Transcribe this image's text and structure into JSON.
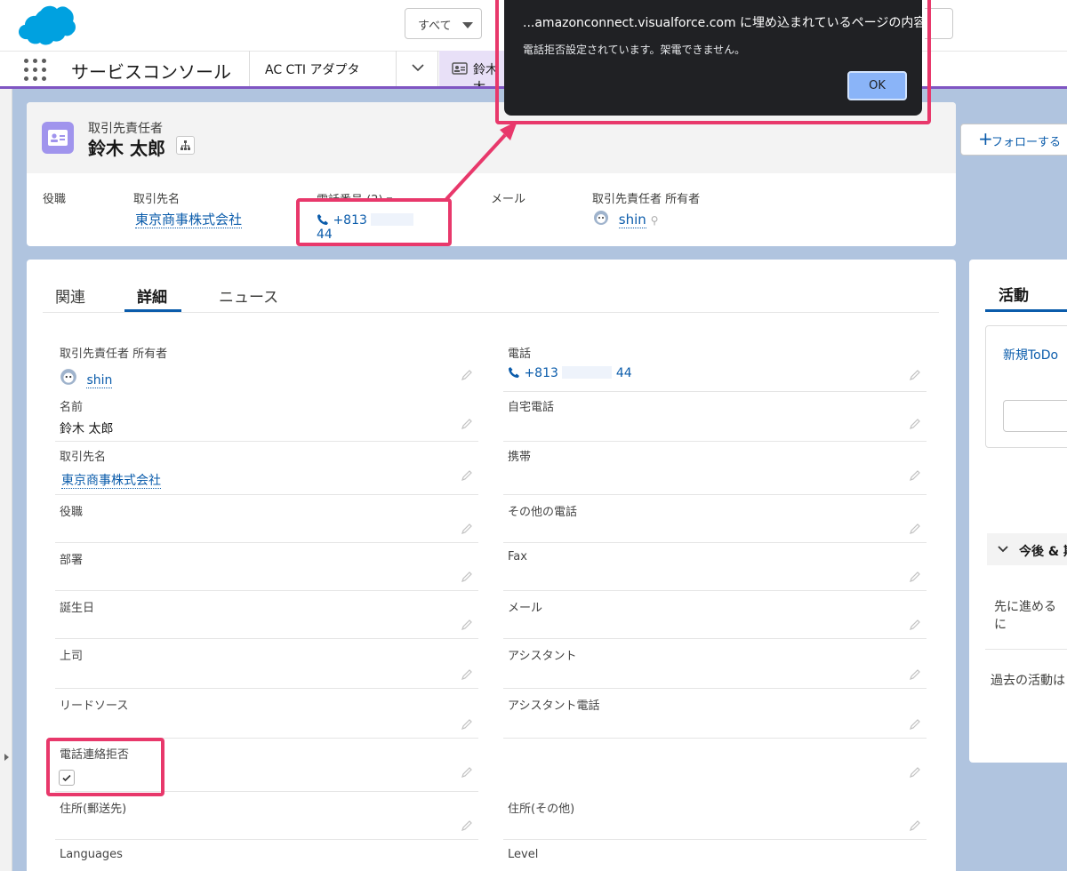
{
  "header": {
    "scope_label": "すべて"
  },
  "nav": {
    "app_name": "サービスコンソール",
    "tabs": [
      {
        "label": "AC CTI アダプタ"
      },
      {
        "label": "鈴木 太"
      }
    ]
  },
  "highlights": {
    "object_label": "取引先責任者",
    "record_name": "鈴木 太郎",
    "follow_label": "フォローする",
    "fields": {
      "title_label": "役職",
      "account_label": "取引先名",
      "account_value": "東京商事株式会社",
      "phone_label": "電話番号 (2)",
      "phone_prefix": "+813",
      "phone_suffix": "44",
      "email_label": "メール",
      "owner_label": "取引先責任者 所有者",
      "owner_value": "shin"
    }
  },
  "detail": {
    "tabs": [
      "関連",
      "詳細",
      "ニュース"
    ],
    "active_tab": "詳細",
    "left_fields": [
      {
        "label": "取引先責任者 所有者",
        "value": "shin"
      },
      {
        "label": "名前",
        "value": "鈴木 太郎"
      },
      {
        "label": "取引先名",
        "value": "東京商事株式会社"
      },
      {
        "label": "役職",
        "value": ""
      },
      {
        "label": "部署",
        "value": ""
      },
      {
        "label": "誕生日",
        "value": ""
      },
      {
        "label": "上司",
        "value": ""
      },
      {
        "label": "リードソース",
        "value": ""
      },
      {
        "label": "電話連絡拒否",
        "value": "checked"
      },
      {
        "label": "住所(郵送先)",
        "value": ""
      },
      {
        "label": "Languages",
        "value": ""
      }
    ],
    "right_fields": [
      {
        "label": "電話",
        "value": "+813 44"
      },
      {
        "label": "自宅電話",
        "value": ""
      },
      {
        "label": "携帯",
        "value": ""
      },
      {
        "label": "その他の電話",
        "value": ""
      },
      {
        "label": "Fax",
        "value": ""
      },
      {
        "label": "メール",
        "value": ""
      },
      {
        "label": "アシスタント",
        "value": ""
      },
      {
        "label": "アシスタント電話",
        "value": ""
      },
      {
        "label": "住所(その他)",
        "value": ""
      },
      {
        "label": "Level",
        "value": ""
      }
    ],
    "phone_prefix": "+813",
    "phone_suffix": "44"
  },
  "activity": {
    "tab_label": "活動",
    "new_todo": "新規ToDo",
    "upcoming": "今後 & 期",
    "next_steps": "先に進めるに",
    "past": "過去の活動は"
  },
  "dialog": {
    "title": "...amazonconnect.visualforce.com に埋め込まれているページの内容",
    "message": "電話拒否設定されています。架電できません。",
    "ok_label": "OK"
  },
  "colors": {
    "brand": "#0b5cab",
    "annotation": "#e8386b",
    "contact_icon": "#a094ed",
    "nav_accent": "#7f55c2"
  }
}
